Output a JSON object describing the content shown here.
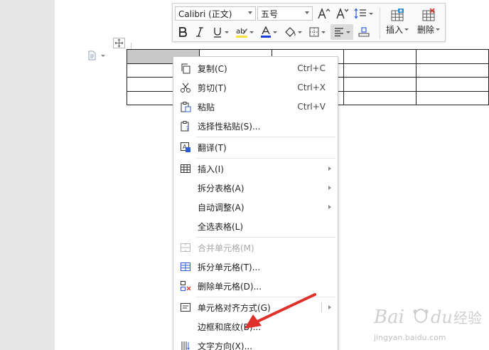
{
  "toolbar": {
    "font_name": "Calibri (正文)",
    "font_size": "五号",
    "insert_label": "插入",
    "delete_label": "删除",
    "colors": {
      "highlight": "#f5e13a",
      "font_color": "#1a3fd6",
      "active_bg": "#dcdcdc"
    }
  },
  "context_menu": {
    "items": [
      {
        "label": "复制(C)",
        "shortcut": "Ctrl+C",
        "icon": "copy-icon"
      },
      {
        "label": "剪切(T)",
        "shortcut": "Ctrl+X",
        "icon": "scissors-icon"
      },
      {
        "label": "粘贴",
        "shortcut": "Ctrl+V",
        "icon": "paste-icon"
      },
      {
        "label": "选择性粘贴(S)...",
        "icon": "paste-special-icon"
      },
      {
        "label": "翻译(T)",
        "icon": "translate-icon"
      },
      {
        "label": "插入(I)",
        "icon": "table-insert-icon",
        "submenu": true
      },
      {
        "label": "拆分表格(A)",
        "submenu": true
      },
      {
        "label": "自动调整(A)",
        "submenu": true
      },
      {
        "label": "全选表格(L)"
      },
      {
        "label": "合并单元格(M)",
        "icon": "merge-cells-icon",
        "disabled": true
      },
      {
        "label": "拆分单元格(T)...",
        "icon": "split-cells-icon"
      },
      {
        "label": "删除单元格(D)...",
        "icon": "delete-cells-icon"
      },
      {
        "label": "单元格对齐方式(G)",
        "icon": "cell-align-icon",
        "submenu": true
      },
      {
        "label": "边框和底纹(B)..."
      },
      {
        "label": "文字方向(X)...",
        "icon": "text-direction-icon"
      }
    ]
  },
  "annotation": {
    "color": "#e0302a"
  },
  "watermark": {
    "brand": "Baidu 经验",
    "url": "jingyan.baidu.com"
  }
}
